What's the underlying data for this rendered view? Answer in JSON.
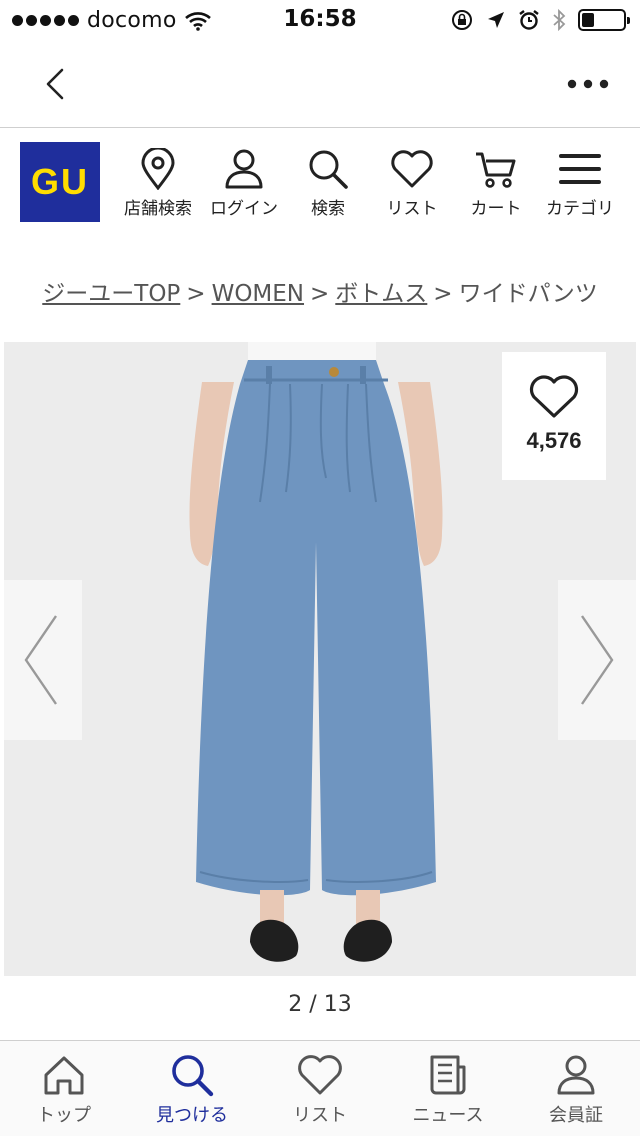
{
  "status_bar": {
    "carrier": "docomo",
    "time": "16:58",
    "battery_level": 0.3
  },
  "header": {
    "logo": "GU",
    "items": [
      {
        "label": "店舗検索",
        "icon": "map-pin-icon"
      },
      {
        "label": "ログイン",
        "icon": "user-icon"
      },
      {
        "label": "検索",
        "icon": "search-icon"
      },
      {
        "label": "リスト",
        "icon": "heart-icon"
      },
      {
        "label": "カート",
        "icon": "cart-icon"
      },
      {
        "label": "カテゴリ",
        "icon": "menu-icon"
      }
    ]
  },
  "breadcrumb": {
    "items": [
      {
        "label": "ジーユーTOP",
        "link": true
      },
      {
        "label": "WOMEN",
        "link": true
      },
      {
        "label": "ボトムス",
        "link": true
      },
      {
        "label": "ワイドパンツ",
        "link": false
      }
    ],
    "separator": ">"
  },
  "gallery": {
    "favorite_count": "4,576",
    "pager": "2 / 13",
    "background_color": "#ececec",
    "pants_color": "#6f95c0"
  },
  "tab_bar": {
    "active_color": "#1f2e9c",
    "tabs": [
      {
        "label": "トップ",
        "icon": "home-icon",
        "active": false
      },
      {
        "label": "見つける",
        "icon": "search-icon",
        "active": true
      },
      {
        "label": "リスト",
        "icon": "heart-icon",
        "active": false
      },
      {
        "label": "ニュース",
        "icon": "news-icon",
        "active": false
      },
      {
        "label": "会員証",
        "icon": "member-icon",
        "active": false
      }
    ]
  }
}
